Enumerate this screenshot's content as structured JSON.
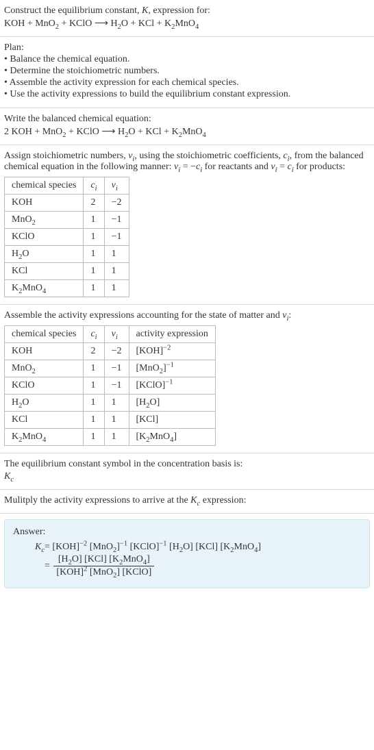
{
  "intro": {
    "line1_pre": "Construct the equilibrium constant, ",
    "line1_post": ", expression for:",
    "eq_lhs": "KOH + MnO",
    "eq_mid1": " + KClO  ⟶  H",
    "eq_mid2": "O + KCl + K",
    "eq_mid3": "MnO"
  },
  "plan": {
    "header": "Plan:",
    "b1": "• Balance the chemical equation.",
    "b2": "• Determine the stoichiometric numbers.",
    "b3": "• Assemble the activity expression for each chemical species.",
    "b4": "• Use the activity expressions to build the equilibrium constant expression."
  },
  "balanced": {
    "header": "Write the balanced chemical equation:",
    "eq_pre": "2 KOH + MnO",
    "eq_mid1": " + KClO  ⟶  H",
    "eq_mid2": "O + KCl + K",
    "eq_mid3": "MnO"
  },
  "assign": {
    "text1": "Assign stoichiometric numbers, ",
    "text2": ", using the stoichiometric coefficients, ",
    "text3": ", from the balanced chemical equation in the following manner: ",
    "text4": " for reactants and ",
    "text5": " for products:",
    "nu_eq_neg_c": " = −",
    "nu_eq_c": " = ",
    "col_species": "chemical species",
    "rows": [
      {
        "sp": "KOH",
        "c": "2",
        "n": "−2"
      },
      {
        "sp": "MnO",
        "sub": "2",
        "c": "1",
        "n": "−1"
      },
      {
        "sp": "KClO",
        "c": "1",
        "n": "−1"
      },
      {
        "sp": "H",
        "sub": "2",
        "tail": "O",
        "c": "1",
        "n": "1"
      },
      {
        "sp": "KCl",
        "c": "1",
        "n": "1"
      },
      {
        "sp": "K",
        "sub": "2",
        "tail": "MnO",
        "sub2": "4",
        "c": "1",
        "n": "1"
      }
    ]
  },
  "assemble": {
    "text1": "Assemble the activity expressions accounting for the state of matter and ",
    "text2": ":",
    "col_species": "chemical species",
    "col_activity": "activity expression",
    "rows": [
      {
        "sp": "KOH",
        "c": "2",
        "n": "−2",
        "act_pre": "[KOH]",
        "act_sup": "−2"
      },
      {
        "sp": "MnO",
        "sub1": "2",
        "c": "1",
        "n": "−1",
        "act_pre": "[MnO",
        "act_sub": "2",
        "act_post": "]",
        "act_sup": "−1"
      },
      {
        "sp": "KClO",
        "c": "1",
        "n": "−1",
        "act_pre": "[KClO]",
        "act_sup": "−1"
      },
      {
        "sp": "H",
        "sub1": "2",
        "tail": "O",
        "c": "1",
        "n": "1",
        "act_pre": "[H",
        "act_sub": "2",
        "act_post": "O]"
      },
      {
        "sp": "KCl",
        "c": "1",
        "n": "1",
        "act_pre": "[KCl]"
      },
      {
        "sp": "K",
        "sub1": "2",
        "tail": "MnO",
        "sub2": "4",
        "c": "1",
        "n": "1",
        "act_pre": "[K",
        "act_sub": "2",
        "act_post": "MnO",
        "act_sub2": "4",
        "act_post2": "]"
      }
    ]
  },
  "symbol": {
    "text": "The equilibrium constant symbol in the concentration basis is:"
  },
  "multiply": {
    "text_pre": "Mulitply the activity expressions to arrive at the ",
    "text_post": " expression:"
  },
  "answer": {
    "label": "Answer:",
    "flat_1": " = [KOH]",
    "flat_2": " [MnO",
    "flat_3": "]",
    "flat_4": " [KClO]",
    "flat_5": " [H",
    "flat_6": "O] [KCl] [K",
    "flat_7": "MnO",
    "flat_8": "]",
    "num_1": "[H",
    "num_2": "O] [KCl] [K",
    "num_3": "MnO",
    "num_4": "]",
    "den_1": "[KOH]",
    "den_2": " [MnO",
    "den_3": "] [KClO]"
  },
  "sym": {
    "K": "K",
    "c": "c",
    "i": "i",
    "nu": "ν",
    "ci": "c",
    "two": "2",
    "four": "4",
    "neg2": "−2",
    "neg1": "−1",
    "sup2": "2"
  }
}
